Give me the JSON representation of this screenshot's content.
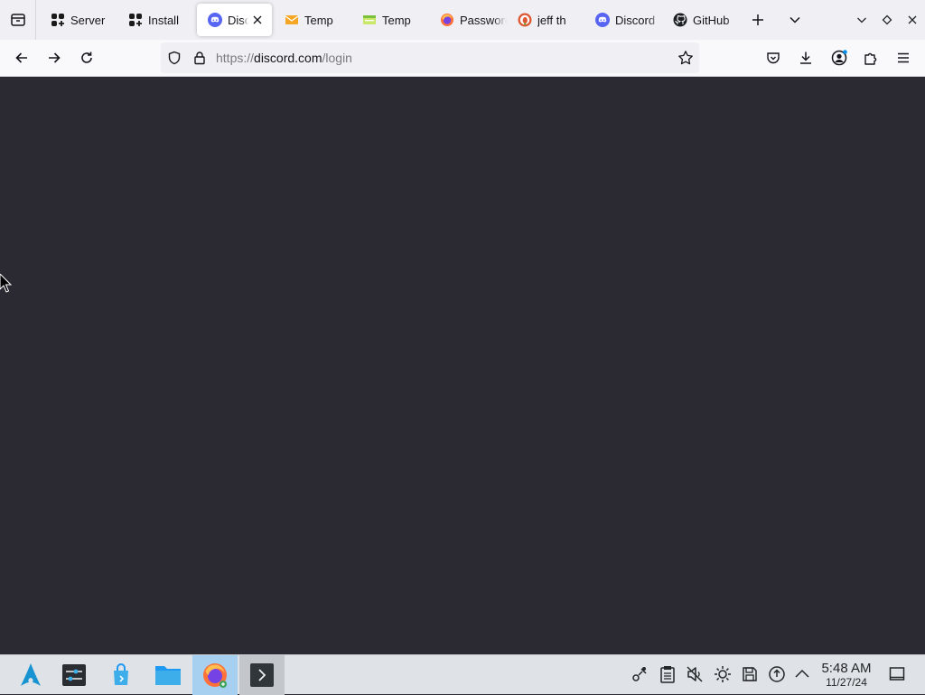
{
  "browser": {
    "tabs": [
      {
        "label": "Server",
        "icon": "server-icon",
        "active": false
      },
      {
        "label": "Install",
        "icon": "server-icon",
        "active": false
      },
      {
        "label": "Discord",
        "icon": "discord-icon",
        "active": true
      },
      {
        "label": "Temp",
        "icon": "mail-icon",
        "active": false
      },
      {
        "label": "Temp",
        "icon": "temp-icon",
        "active": false
      },
      {
        "label": "Password",
        "icon": "firefox-icon",
        "active": false
      },
      {
        "label": "jeff th",
        "icon": "duckduckgo-icon",
        "active": false
      },
      {
        "label": "Discord",
        "icon": "discord-icon",
        "active": false
      },
      {
        "label": "GitHub",
        "icon": "github-icon",
        "active": false
      }
    ],
    "url": {
      "scheme": "https://",
      "host": "discord.com",
      "path": "/login"
    }
  },
  "taskbar": {
    "apps": [
      "arch-launcher-icon",
      "system-settings-icon",
      "discover-store-icon",
      "file-manager-icon",
      "firefox-icon",
      "terminal-icon"
    ],
    "clock": {
      "time": "5:48 AM",
      "date": "11/27/24"
    }
  },
  "colors": {
    "page_background": "#2b2a33",
    "tab_strip": "#f0f0f4",
    "discord_blurple": "#5865f2",
    "taskbar": "#dfe2e6",
    "active_task": "#a7cff0"
  }
}
